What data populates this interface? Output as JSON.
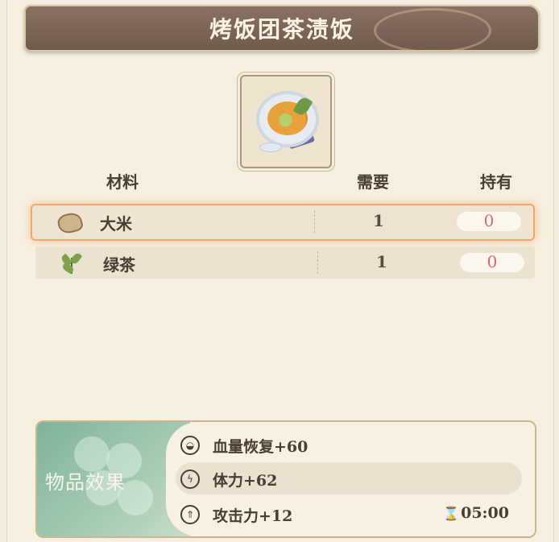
{
  "title": "烤饭团茶渍饭",
  "table": {
    "headers": {
      "material": "材料",
      "need": "需要",
      "have": "持有"
    },
    "rows": [
      {
        "icon": "rice-icon",
        "name": "大米",
        "need": "1",
        "have": "0",
        "selected": true
      },
      {
        "icon": "tea-leaf-icon",
        "name": "绿茶",
        "need": "1",
        "have": "0",
        "selected": false
      }
    ]
  },
  "effects": {
    "title": "物品效果",
    "items": [
      {
        "icon": "hp-restore-icon",
        "text": "血量恢复+60"
      },
      {
        "icon": "stamina-icon",
        "text": "体力+62"
      },
      {
        "icon": "attack-icon",
        "text": "攻击力+12"
      }
    ],
    "duration": "05:00"
  },
  "colors": {
    "title_bar": "#7c6558",
    "highlight": "#f1a66d",
    "have_zero": "#d46b6b",
    "effects_green": "#8fbfa4"
  }
}
